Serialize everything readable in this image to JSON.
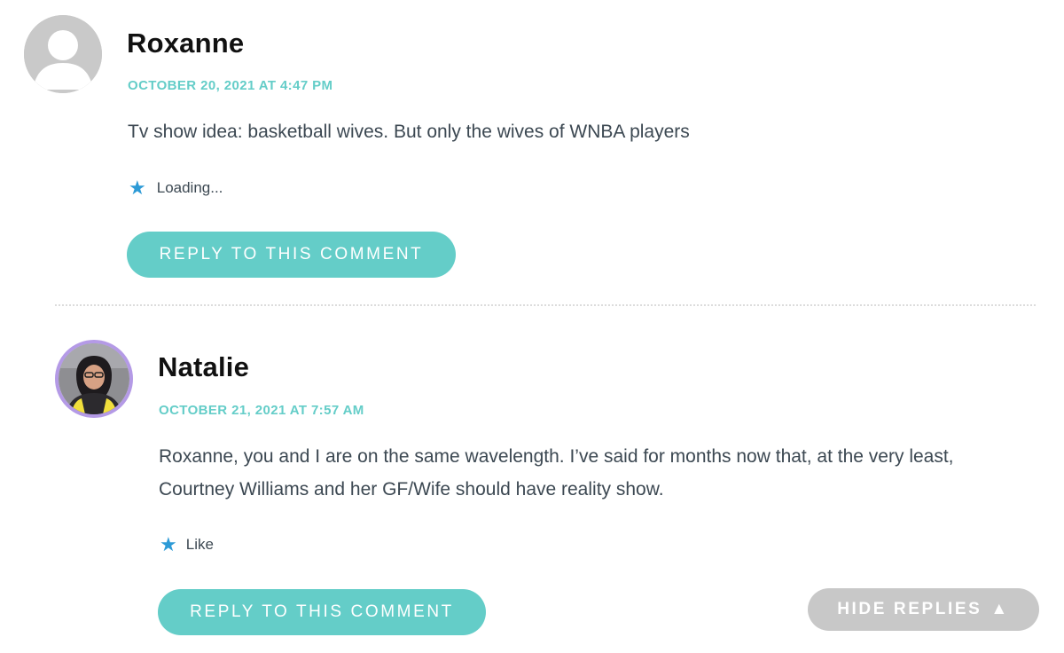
{
  "comments": [
    {
      "author": "Roxanne",
      "date": "OCTOBER 20, 2021 AT 4:47 PM",
      "text": "Tv show idea: basketball wives. But only the wives of WNBA players",
      "like_label": "Loading...",
      "reply_label": "REPLY TO THIS COMMENT",
      "avatar": "default-avatar-icon"
    },
    {
      "author": "Natalie",
      "date": "OCTOBER 21, 2021 AT 7:57 AM",
      "text_lines": [
        "Roxanne, you and I are on the same wavelength. I’ve said for months now that, at the very least,",
        "Courtney Williams and her GF/Wife should have reality show."
      ],
      "like_label": "Like",
      "reply_label": "REPLY TO THIS COMMENT",
      "avatar": "user-photo-avatar"
    }
  ],
  "hide_replies": {
    "label": "HIDE REPLIES",
    "icon": "triangle-up-icon"
  },
  "colors": {
    "accent": "#64cdc8",
    "star": "#2c9ad6",
    "hide_button": "#c8c8c8",
    "avatar_ring": "#b49ae6"
  }
}
